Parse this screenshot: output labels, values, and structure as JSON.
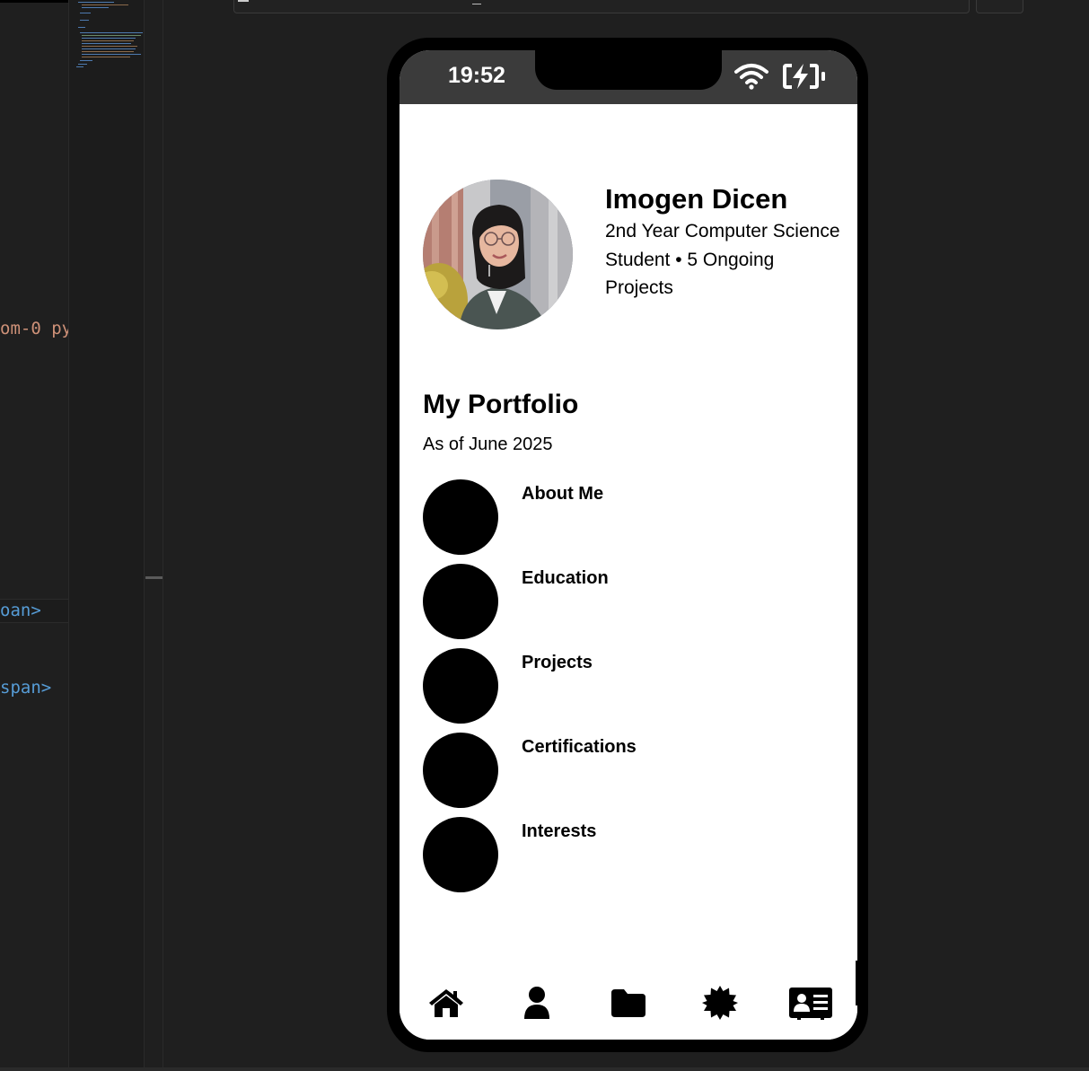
{
  "editor": {
    "code_line_1": "om-0 py",
    "code_line_2": "oan>",
    "code_line_3": "span>"
  },
  "status_bar": {
    "time": "19:52",
    "icons": [
      "wifi-icon",
      "battery-charging-icon"
    ]
  },
  "profile": {
    "name": "Imogen Dicen",
    "subtitle": "2nd Year Computer Science Student • 5 Ongoing Projects",
    "avatar_alt": "profile photo"
  },
  "portfolio": {
    "title": "My Portfolio",
    "subtitle": "As of June 2025",
    "items": [
      {
        "label": "About Me"
      },
      {
        "label": "Education"
      },
      {
        "label": "Projects"
      },
      {
        "label": "Certifications"
      },
      {
        "label": "Interests"
      }
    ]
  },
  "tab_bar": {
    "tabs": [
      {
        "icon": "home-icon"
      },
      {
        "icon": "user-icon"
      },
      {
        "icon": "folder-icon"
      },
      {
        "icon": "badge-icon"
      },
      {
        "icon": "contact-card-icon"
      }
    ]
  },
  "colors": {
    "status_bar_bg": "#3b3b3b",
    "phone_frame": "#000000",
    "screen_bg": "#ffffff",
    "editor_bg": "#1f1f1f",
    "code_string": "#ce9178",
    "code_tag": "#569cd6"
  }
}
